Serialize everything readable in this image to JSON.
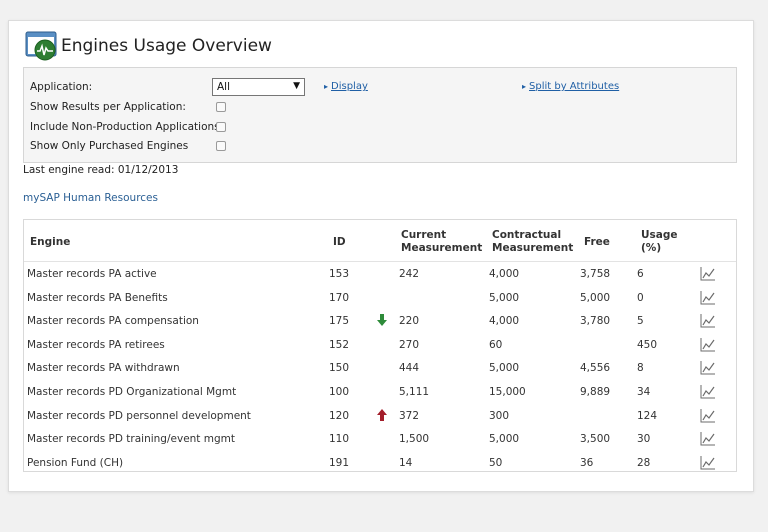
{
  "page": {
    "title": "Engines Usage Overview",
    "header_icon": "monitor-chart-icon"
  },
  "filters": {
    "application_label": "Application:",
    "application_value": "All",
    "show_results_label": "Show Results per Application:",
    "include_nonprod_label": "Include Non-Production Applications",
    "show_purchased_label": "Show Only Purchased Engines",
    "display_link": "Display",
    "split_link": "Split by Attributes"
  },
  "last_read": "Last engine read: 01/12/2013",
  "group_title": "mySAP Human Resources",
  "table": {
    "headers": {
      "engine": "Engine",
      "id": "ID",
      "current_1": "Current",
      "current_2": "Measurement",
      "contract_1": "Contractual",
      "contract_2": "Measurement",
      "free": "Free",
      "usage_1": "Usage",
      "usage_2": "(%)"
    },
    "rows": [
      {
        "engine": "Master records PA active",
        "id": "153",
        "trend": "",
        "current": "242",
        "contractual": "4,000",
        "free": "3,758",
        "usage": "6"
      },
      {
        "engine": "Master records PA Benefits",
        "id": "170",
        "trend": "",
        "current": "",
        "contractual": "5,000",
        "free": "5,000",
        "usage": "0"
      },
      {
        "engine": "Master records PA compensation",
        "id": "175",
        "trend": "down",
        "current": "220",
        "contractual": "4,000",
        "free": "3,780",
        "usage": "5"
      },
      {
        "engine": "Master records PA retirees",
        "id": "152",
        "trend": "",
        "current": "270",
        "contractual": "60",
        "free": "",
        "usage": "450"
      },
      {
        "engine": "Master records PA withdrawn",
        "id": "150",
        "trend": "",
        "current": "444",
        "contractual": "5,000",
        "free": "4,556",
        "usage": "8"
      },
      {
        "engine": "Master records PD Organizational Mgmt",
        "id": "100",
        "trend": "",
        "current": "5,111",
        "contractual": "15,000",
        "free": "9,889",
        "usage": "34"
      },
      {
        "engine": "Master records PD personnel development",
        "id": "120",
        "trend": "up",
        "current": "372",
        "contractual": "300",
        "free": "",
        "usage": "124"
      },
      {
        "engine": "Master records PD training/event mgmt",
        "id": "110",
        "trend": "",
        "current": "1,500",
        "contractual": "5,000",
        "free": "3,500",
        "usage": "30"
      },
      {
        "engine": "Pension Fund (CH)",
        "id": "191",
        "trend": "",
        "current": "14",
        "contractual": "50",
        "free": "36",
        "usage": "28"
      }
    ]
  },
  "colors": {
    "link": "#1f5fa5",
    "trend_down": "#2e8b3a",
    "trend_up": "#a31d2a"
  }
}
